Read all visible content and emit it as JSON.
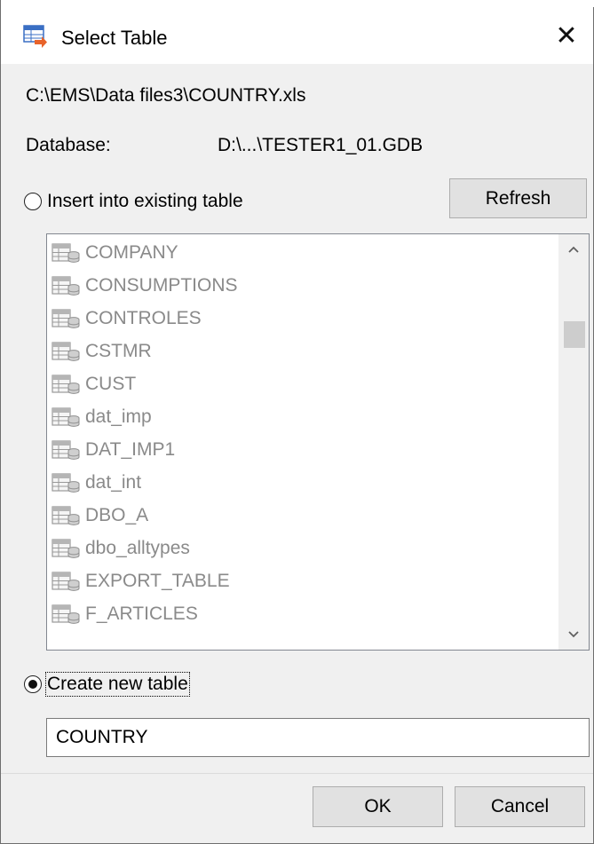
{
  "window": {
    "title": "Select Table",
    "close_glyph": "✕",
    "icon": "select-table-app-icon"
  },
  "info": {
    "file_path": "C:\\EMS\\Data files3\\COUNTRY.xls",
    "database_label": "Database:",
    "database_value": "D:\\...\\TESTER1_01.GDB"
  },
  "options": {
    "existing_label": "Insert into existing table",
    "existing_checked": false,
    "new_label": "Create new table",
    "new_checked": true
  },
  "buttons": {
    "refresh": "Refresh",
    "ok": "OK",
    "cancel": "Cancel"
  },
  "table_list": {
    "icon": "table-icon",
    "items": [
      "COMPANY",
      "CONSUMPTIONS",
      "CONTROLES",
      "CSTMR",
      "CUST",
      "dat_imp",
      "DAT_IMP1",
      "dat_int",
      "DBO_A",
      "dbo_alltypes",
      "EXPORT_TABLE",
      "F_ARTICLES"
    ]
  },
  "new_table_name": "COUNTRY",
  "colors": {
    "dialog_bg": "#f0f0f0",
    "disabled_text": "#8a8a8a",
    "button_bg": "#e1e1e1"
  }
}
